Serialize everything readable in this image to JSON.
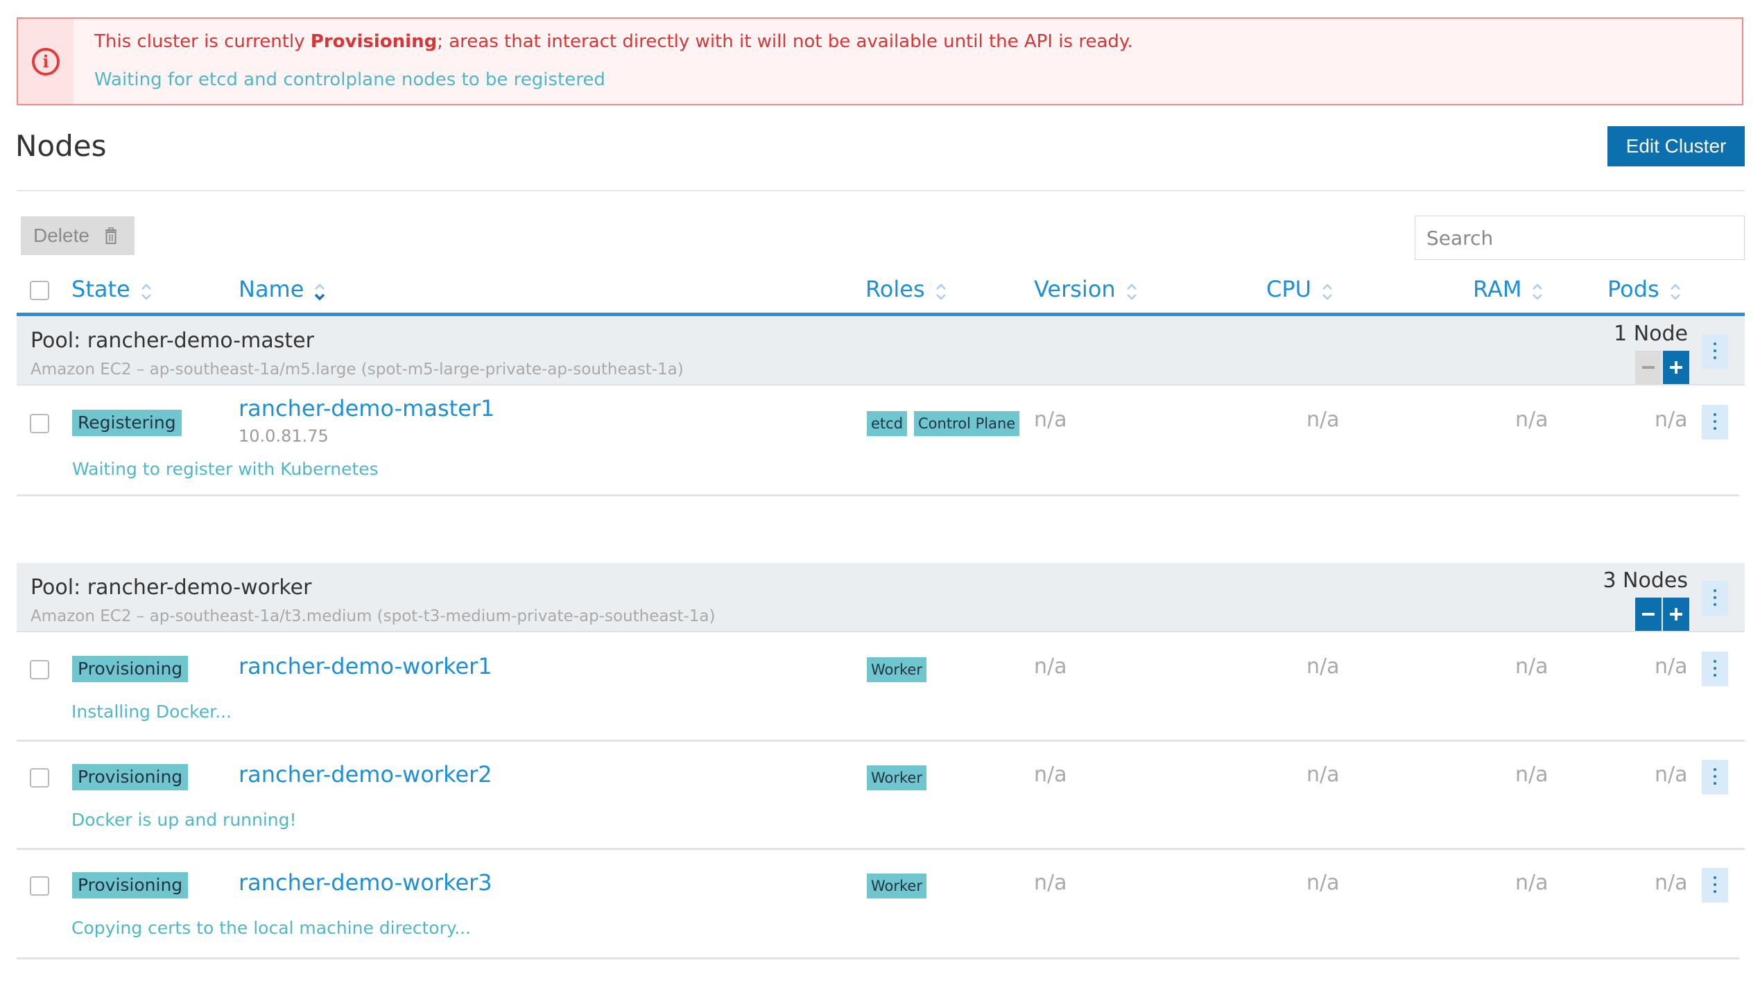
{
  "banner": {
    "message_before": "This cluster is currently ",
    "message_state": "Provisioning",
    "message_after": "; areas that interact directly with it will not be available until the API is ready.",
    "sub": "Waiting for etcd and controlplane nodes to be registered",
    "icon": "alert-circle-icon",
    "color": "#d63636"
  },
  "header": {
    "title": "Nodes",
    "edit_button": "Edit Cluster"
  },
  "toolbar": {
    "delete_label": "Delete",
    "search_placeholder": "Search"
  },
  "columns": {
    "state": "State",
    "name": "Name",
    "roles": "Roles",
    "version": "Version",
    "cpu": "CPU",
    "ram": "RAM",
    "pods": "Pods"
  },
  "pools": [
    {
      "name": "Pool: rancher-demo-master",
      "desc": "Amazon EC2 – ap-southeast-1a/m5.large (spot-m5-large-private-ap-southeast-1a)",
      "count": "1 Node",
      "nodes": [
        {
          "state": "Registering",
          "name": "rancher-demo-master1",
          "ip": "10.0.81.75",
          "roles": [
            "etcd",
            "Control Plane"
          ],
          "version": "n/a",
          "cpu": "n/a",
          "ram": "n/a",
          "pods": "n/a",
          "status": "Waiting to register with Kubernetes"
        }
      ]
    },
    {
      "name": "Pool: rancher-demo-worker",
      "desc": "Amazon EC2 – ap-southeast-1a/t3.medium (spot-t3-medium-private-ap-southeast-1a)",
      "count": "3 Nodes",
      "nodes": [
        {
          "state": "Provisioning",
          "name": "rancher-demo-worker1",
          "roles": [
            "Worker"
          ],
          "version": "n/a",
          "cpu": "n/a",
          "ram": "n/a",
          "pods": "n/a",
          "status": "Installing Docker..."
        },
        {
          "state": "Provisioning",
          "name": "rancher-demo-worker2",
          "roles": [
            "Worker"
          ],
          "version": "n/a",
          "cpu": "n/a",
          "ram": "n/a",
          "pods": "n/a",
          "status": "Docker is up and running!"
        },
        {
          "state": "Provisioning",
          "name": "rancher-demo-worker3",
          "roles": [
            "Worker"
          ],
          "version": "n/a",
          "cpu": "n/a",
          "ram": "n/a",
          "pods": "n/a",
          "status": "Copying certs to the local machine directory..."
        }
      ]
    }
  ],
  "colors": {
    "accent": "#0c6fae",
    "link": "#1c8fd6",
    "badge": "#6fc6cf",
    "banner_bg": "#fff3f3"
  }
}
